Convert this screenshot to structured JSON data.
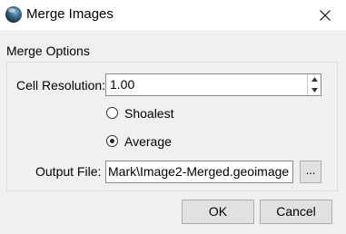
{
  "window": {
    "title": "Merge Images",
    "app_icon": "globe-icon",
    "close_icon": "close-icon"
  },
  "group": {
    "title": "Merge Options"
  },
  "cell_resolution": {
    "label": "Cell Resolution:",
    "value": "1.00"
  },
  "merge_mode": {
    "options": [
      {
        "label": "Shoalest",
        "checked": false
      },
      {
        "label": "Average",
        "checked": true
      }
    ]
  },
  "output_file": {
    "label": "Output File:",
    "value": "Mark\\Image2-Merged.geoimage",
    "browse_label": "..."
  },
  "buttons": {
    "ok": "OK",
    "cancel": "Cancel"
  }
}
